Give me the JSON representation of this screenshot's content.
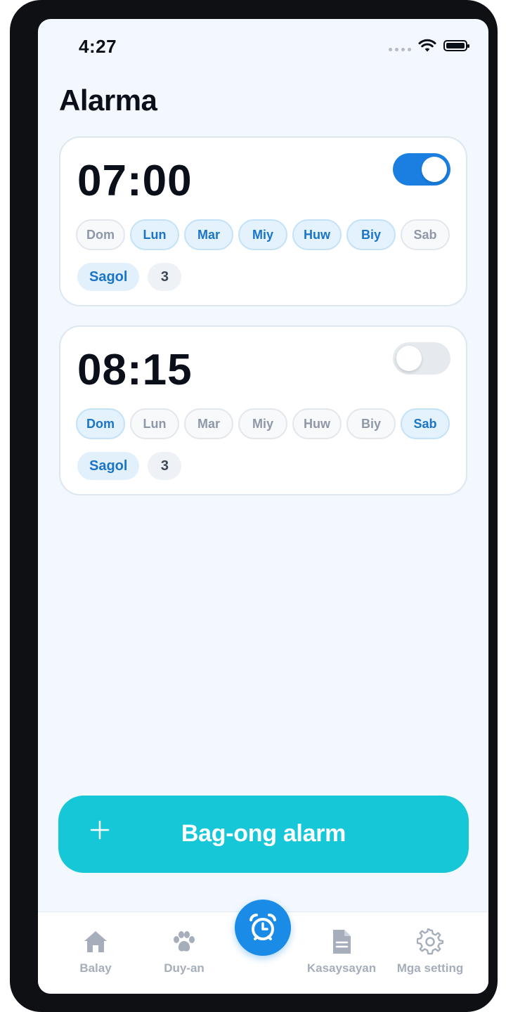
{
  "status_bar": {
    "time": "4:27"
  },
  "page_title": "Alarma",
  "alarms": [
    {
      "time": "07:00",
      "enabled": true,
      "days": [
        {
          "label": "Dom",
          "active": false
        },
        {
          "label": "Lun",
          "active": true
        },
        {
          "label": "Mar",
          "active": true
        },
        {
          "label": "Miy",
          "active": true
        },
        {
          "label": "Huw",
          "active": true
        },
        {
          "label": "Biy",
          "active": true
        },
        {
          "label": "Sab",
          "active": false
        }
      ],
      "sound": "Sagol",
      "count": "3"
    },
    {
      "time": "08:15",
      "enabled": false,
      "days": [
        {
          "label": "Dom",
          "active": true
        },
        {
          "label": "Lun",
          "active": false
        },
        {
          "label": "Mar",
          "active": false
        },
        {
          "label": "Miy",
          "active": false
        },
        {
          "label": "Huw",
          "active": false
        },
        {
          "label": "Biy",
          "active": false
        },
        {
          "label": "Sab",
          "active": true
        }
      ],
      "sound": "Sagol",
      "count": "3"
    }
  ],
  "new_alarm_button": {
    "icon": "plus-icon",
    "label": "Bag-ong alarm"
  },
  "tabbar": {
    "tabs": [
      {
        "label": "Balay",
        "icon": "home-icon"
      },
      {
        "label": "Duy-an",
        "icon": "paw-icon"
      },
      {
        "label": "",
        "icon": "alarm-clock-icon",
        "active": true
      },
      {
        "label": "Kasaysayan",
        "icon": "document-icon"
      },
      {
        "label": "Mga setting",
        "icon": "gear-icon"
      }
    ]
  },
  "colors": {
    "accent": "#1a7fe0",
    "button": "#16c7d8",
    "background": "#f2f8fd",
    "tab_inactive": "#a6aebb"
  }
}
